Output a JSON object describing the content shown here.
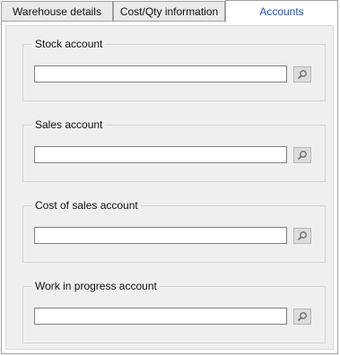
{
  "tabs": [
    {
      "label": "Warehouse details"
    },
    {
      "label": "Cost/Qty information"
    },
    {
      "label": "Accounts"
    }
  ],
  "accounts": {
    "stock": {
      "label": "Stock account",
      "value": ""
    },
    "sales": {
      "label": "Sales account",
      "value": ""
    },
    "cost_of_sales": {
      "label": "Cost of sales account",
      "value": ""
    },
    "work_in_progress": {
      "label": "Work in progress account",
      "value": ""
    }
  },
  "icons": {
    "lookup": "magnifier-icon"
  },
  "colors": {
    "active_tab_text": "#1f4fd1",
    "panel_bg": "#eef0f0"
  }
}
